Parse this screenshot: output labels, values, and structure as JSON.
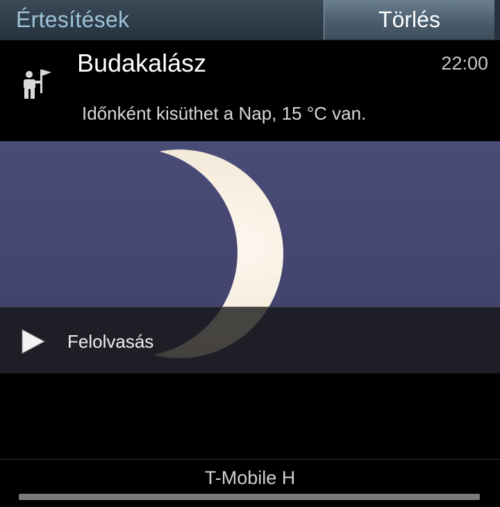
{
  "header": {
    "title": "Értesítések",
    "clear_label": "Törlés"
  },
  "notification": {
    "icon": "hiker-with-flag-icon",
    "title": "Budakalász",
    "time": "22:00",
    "text": "Időnként kisüthet a Nap, 15 °C van.",
    "picture": "crescent-moon-image",
    "action": {
      "icon": "play-icon",
      "label": "Felolvasás"
    }
  },
  "carrier": {
    "label": "T-Mobile H"
  },
  "colors": {
    "header_bg": "#2f3d49",
    "header_title": "#9ec3d9",
    "button_bg": "#56697a",
    "sky": "#44466e",
    "background": "#000000"
  }
}
